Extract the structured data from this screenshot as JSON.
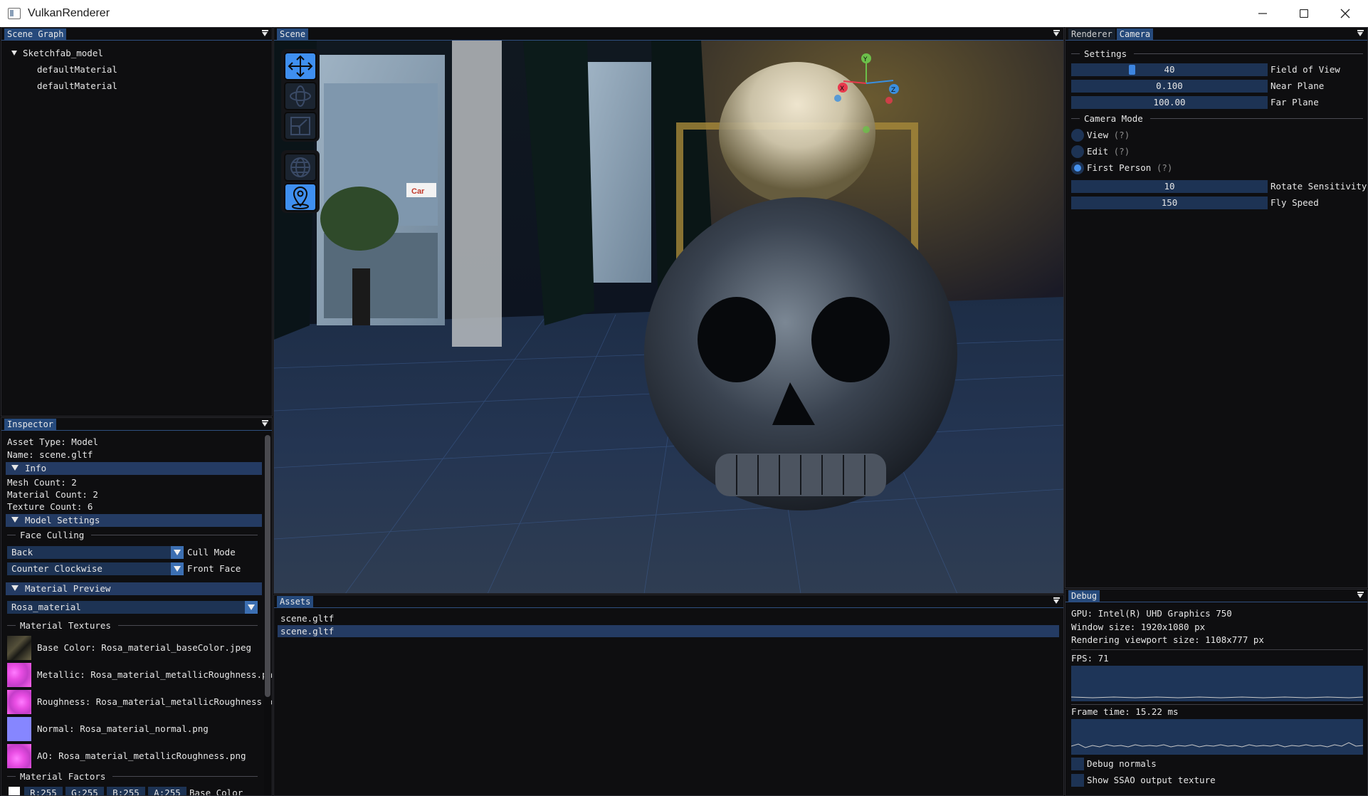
{
  "window": {
    "title": "VulkanRenderer"
  },
  "scene_graph": {
    "tab": "Scene Graph",
    "root": "Sketchfab_model",
    "children": [
      "defaultMaterial",
      "defaultMaterial"
    ]
  },
  "inspector": {
    "tab": "Inspector",
    "asset_type": "Asset Type: Model",
    "name": "Name: scene.gltf",
    "info_header": "Info",
    "mesh_count": "Mesh Count: 2",
    "material_count": "Material Count: 2",
    "texture_count": "Texture Count: 6",
    "model_settings_header": "Model Settings",
    "face_culling_label": "Face Culling",
    "cull_mode_value": "Back",
    "cull_mode_label": "Cull Mode",
    "front_face_value": "Counter Clockwise",
    "front_face_label": "Front Face",
    "material_preview_header": "Material Preview",
    "material_selected": "Rosa_material",
    "material_textures_label": "Material Textures",
    "textures": [
      {
        "label": "Base Color: Rosa_material_baseColor.jpeg",
        "kind": "dark-photo"
      },
      {
        "label": "Metallic: Rosa_material_metallicRoughness.png",
        "kind": "magenta"
      },
      {
        "label": "Roughness: Rosa_material_metallicRoughness.pn",
        "kind": "magenta"
      },
      {
        "label": "Normal: Rosa_material_normal.png",
        "kind": "normal-blue"
      },
      {
        "label": "AO: Rosa_material_metallicRoughness.png",
        "kind": "magenta"
      }
    ],
    "material_factors_label": "Material Factors",
    "base_color": {
      "r": "R:255",
      "g": "G:255",
      "b": "B:255",
      "a": "A:255",
      "label": "Base Color"
    }
  },
  "scene": {
    "tab": "Scene",
    "gizmo_tools": [
      "translate-icon",
      "rotate-icon",
      "scale-icon"
    ],
    "gizmo_spaces": [
      "globe-icon",
      "location-pin-icon"
    ],
    "axes": {
      "x": "X",
      "y": "Y",
      "z": "Z"
    },
    "billboard_text": "Car",
    "colors": {
      "x_axis": "#e8394d",
      "y_axis": "#6cc04a",
      "z_axis": "#3a8fe0"
    }
  },
  "renderer_camera": {
    "tabs": [
      "Renderer",
      "Camera"
    ],
    "settings_label": "Settings",
    "field_of_view": {
      "value": "40",
      "label": "Field of View",
      "slider_fraction": 0.3
    },
    "near_plane": {
      "value": "0.100",
      "label": "Near Plane"
    },
    "far_plane": {
      "value": "100.00",
      "label": "Far Plane"
    },
    "camera_mode_label": "Camera Mode",
    "modes": [
      {
        "label": "View",
        "hint": "(?)",
        "selected": false
      },
      {
        "label": "Edit",
        "hint": "(?)",
        "selected": false
      },
      {
        "label": "First Person",
        "hint": "(?)",
        "selected": true
      }
    ],
    "rotate_sensitivity": {
      "value": "10",
      "label": "Rotate Sensitivity"
    },
    "fly_speed": {
      "value": "150",
      "label": "Fly Speed"
    }
  },
  "assets": {
    "tab": "Assets",
    "items": [
      "scene.gltf",
      "scene.gltf"
    ],
    "selected_index": 1
  },
  "debug": {
    "tab": "Debug",
    "gpu": "GPU: Intel(R) UHD Graphics 750",
    "window_size": "Window size: 1920x1080 px",
    "viewport_size": "Rendering viewport size: 1108x777 px",
    "fps": "FPS: 71",
    "frame_time": "Frame time: 15.22 ms",
    "debug_normals": "Debug normals",
    "show_ssao": "Show SSAO output texture"
  }
}
